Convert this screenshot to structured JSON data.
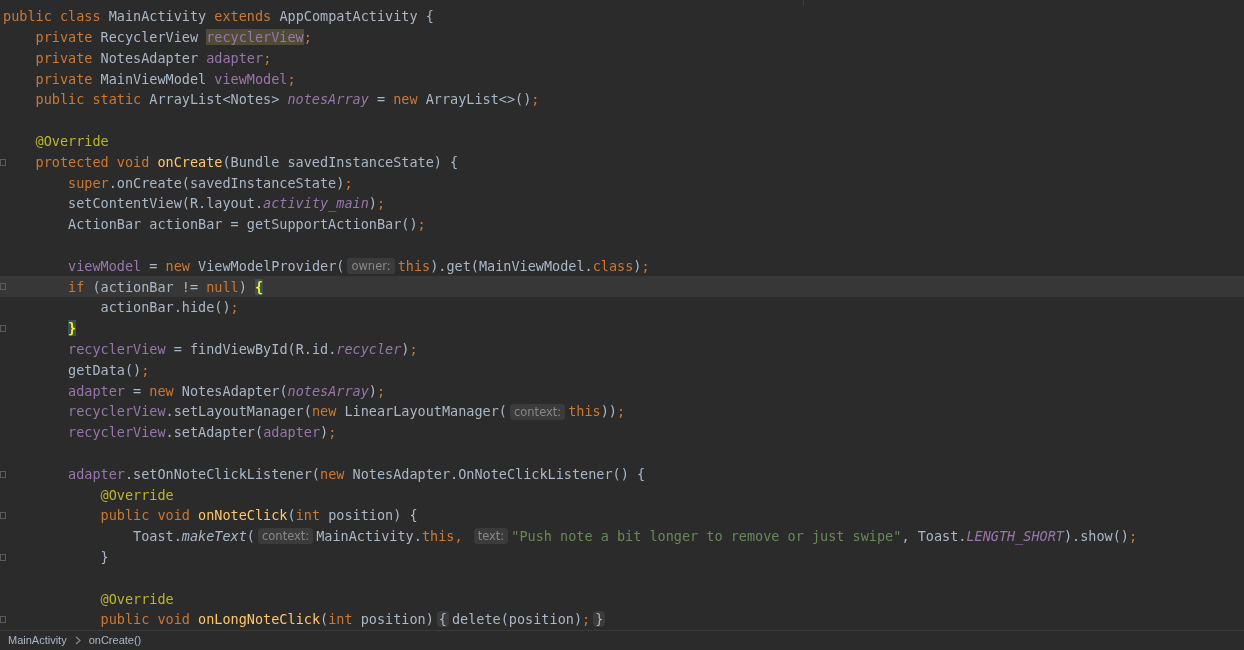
{
  "editor": {
    "lines": [
      {
        "fold_marker": false,
        "current": false,
        "tokens": [
          {
            "kind": "kw",
            "text": "public class "
          },
          {
            "kind": "plain",
            "text": "MainActivity "
          },
          {
            "kind": "kw",
            "text": "extends "
          },
          {
            "kind": "plain",
            "text": "AppCompatActivity {"
          }
        ]
      },
      {
        "fold_marker": false,
        "current": false,
        "tokens": [
          {
            "kind": "kw",
            "text": "    private "
          },
          {
            "kind": "plain",
            "text": "RecyclerView "
          },
          {
            "kind": "usage",
            "text": "recyclerView"
          },
          {
            "kind": "kw",
            "text": ";"
          }
        ]
      },
      {
        "fold_marker": false,
        "current": false,
        "tokens": [
          {
            "kind": "kw",
            "text": "    private "
          },
          {
            "kind": "plain",
            "text": "NotesAdapter "
          },
          {
            "kind": "field",
            "text": "adapter"
          },
          {
            "kind": "kw",
            "text": ";"
          }
        ]
      },
      {
        "fold_marker": false,
        "current": false,
        "tokens": [
          {
            "kind": "kw",
            "text": "    private "
          },
          {
            "kind": "plain",
            "text": "MainViewModel "
          },
          {
            "kind": "field",
            "text": "viewModel"
          },
          {
            "kind": "kw",
            "text": ";"
          }
        ]
      },
      {
        "fold_marker": false,
        "current": false,
        "tokens": [
          {
            "kind": "kw",
            "text": "    public static "
          },
          {
            "kind": "plain",
            "text": "ArrayList<Notes> "
          },
          {
            "kind": "static",
            "text": "notesArray"
          },
          {
            "kind": "plain",
            "text": " = "
          },
          {
            "kind": "kw",
            "text": "new "
          },
          {
            "kind": "plain",
            "text": "ArrayList<>()"
          },
          {
            "kind": "kw",
            "text": ";"
          }
        ]
      },
      {
        "fold_marker": false,
        "current": false
      },
      {
        "fold_marker": false,
        "current": false,
        "tokens": [
          {
            "kind": "annotation",
            "text": "    @Override"
          }
        ]
      },
      {
        "fold_marker": true,
        "current": false,
        "tokens": [
          {
            "kind": "kw",
            "text": "    protected void "
          },
          {
            "kind": "method",
            "text": "onCreate"
          },
          {
            "kind": "plain",
            "text": "(Bundle savedInstanceState) {"
          }
        ]
      },
      {
        "fold_marker": false,
        "current": false,
        "tokens": [
          {
            "kind": "kw",
            "text": "        super"
          },
          {
            "kind": "plain",
            "text": ".onCreate(savedInstanceState)"
          },
          {
            "kind": "kw",
            "text": ";"
          }
        ]
      },
      {
        "fold_marker": false,
        "current": false,
        "tokens": [
          {
            "kind": "plain",
            "text": "        setContentView(R.layout."
          },
          {
            "kind": "static",
            "text": "activity_main"
          },
          {
            "kind": "plain",
            "text": ")"
          },
          {
            "kind": "kw",
            "text": ";"
          }
        ]
      },
      {
        "fold_marker": false,
        "current": false,
        "tokens": [
          {
            "kind": "plain",
            "text": "        ActionBar actionBar = getSupportActionBar()"
          },
          {
            "kind": "kw",
            "text": ";"
          }
        ]
      },
      {
        "fold_marker": false,
        "current": false
      },
      {
        "fold_marker": false,
        "current": false,
        "tokens": [
          {
            "kind": "field",
            "text": "        viewModel"
          },
          {
            "kind": "plain",
            "text": " = "
          },
          {
            "kind": "kw",
            "text": "new "
          },
          {
            "kind": "plain",
            "text": "ViewModelProvider("
          },
          {
            "kind": "hint",
            "text": "owner:"
          },
          {
            "kind": "kw",
            "text": "this"
          },
          {
            "kind": "plain",
            "text": ").get(MainViewModel."
          },
          {
            "kind": "kw",
            "text": "class"
          },
          {
            "kind": "plain",
            "text": ")"
          },
          {
            "kind": "kw",
            "text": ";"
          }
        ]
      },
      {
        "fold_marker": true,
        "current": true,
        "tokens": [
          {
            "kind": "kw",
            "text": "        if "
          },
          {
            "kind": "plain",
            "text": "(actionBar != "
          },
          {
            "kind": "kw",
            "text": "null"
          },
          {
            "kind": "plain",
            "text": ") "
          },
          {
            "kind": "brace",
            "text": "{"
          }
        ]
      },
      {
        "fold_marker": false,
        "current": false,
        "tokens": [
          {
            "kind": "plain",
            "text": "            actionBar.hide()"
          },
          {
            "kind": "kw",
            "text": ";"
          }
        ]
      },
      {
        "fold_marker": true,
        "current": false,
        "tokens": [
          {
            "kind": "brace",
            "text": "        }"
          }
        ]
      },
      {
        "fold_marker": false,
        "current": false,
        "tokens": [
          {
            "kind": "field",
            "text": "        recyclerView"
          },
          {
            "kind": "plain",
            "text": " = findViewById(R.id."
          },
          {
            "kind": "static",
            "text": "recycler"
          },
          {
            "kind": "plain",
            "text": ")"
          },
          {
            "kind": "kw",
            "text": ";"
          }
        ]
      },
      {
        "fold_marker": false,
        "current": false,
        "tokens": [
          {
            "kind": "plain",
            "text": "        getData()"
          },
          {
            "kind": "kw",
            "text": ";"
          }
        ]
      },
      {
        "fold_marker": false,
        "current": false,
        "tokens": [
          {
            "kind": "field",
            "text": "        adapter"
          },
          {
            "kind": "plain",
            "text": " = "
          },
          {
            "kind": "kw",
            "text": "new "
          },
          {
            "kind": "plain",
            "text": "NotesAdapter("
          },
          {
            "kind": "static",
            "text": "notesArray"
          },
          {
            "kind": "plain",
            "text": ")"
          },
          {
            "kind": "kw",
            "text": ";"
          }
        ]
      },
      {
        "fold_marker": false,
        "current": false,
        "tokens": [
          {
            "kind": "field",
            "text": "        recyclerView"
          },
          {
            "kind": "plain",
            "text": ".setLayoutManager("
          },
          {
            "kind": "kw",
            "text": "new "
          },
          {
            "kind": "plain",
            "text": "LinearLayoutManager("
          },
          {
            "kind": "hint",
            "text": "context:"
          },
          {
            "kind": "kw",
            "text": "this"
          },
          {
            "kind": "plain",
            "text": "))"
          },
          {
            "kind": "kw",
            "text": ";"
          }
        ]
      },
      {
        "fold_marker": false,
        "current": false,
        "tokens": [
          {
            "kind": "field",
            "text": "        recyclerView"
          },
          {
            "kind": "plain",
            "text": ".setAdapter("
          },
          {
            "kind": "field",
            "text": "adapter"
          },
          {
            "kind": "plain",
            "text": ")"
          },
          {
            "kind": "kw",
            "text": ";"
          }
        ]
      },
      {
        "fold_marker": false,
        "current": false
      },
      {
        "fold_marker": true,
        "current": false,
        "tokens": [
          {
            "kind": "field",
            "text": "        adapter"
          },
          {
            "kind": "plain",
            "text": ".setOnNoteClickListener("
          },
          {
            "kind": "kw",
            "text": "new "
          },
          {
            "kind": "plain",
            "text": "NotesAdapter.OnNoteClickListener() {"
          }
        ]
      },
      {
        "fold_marker": false,
        "current": false,
        "tokens": [
          {
            "kind": "annotation",
            "text": "            @Override"
          }
        ]
      },
      {
        "fold_marker": true,
        "current": false,
        "tokens": [
          {
            "kind": "kw",
            "text": "            public void "
          },
          {
            "kind": "method",
            "text": "onNoteClick"
          },
          {
            "kind": "plain",
            "text": "("
          },
          {
            "kind": "kw",
            "text": "int "
          },
          {
            "kind": "plain",
            "text": "position) {"
          }
        ]
      },
      {
        "fold_marker": false,
        "current": false,
        "tokens": [
          {
            "kind": "plain",
            "text": "                Toast."
          },
          {
            "kind": "italic",
            "text": "makeText"
          },
          {
            "kind": "plain",
            "text": "("
          },
          {
            "kind": "hint",
            "text": "context:"
          },
          {
            "kind": "plain",
            "text": "MainActivity."
          },
          {
            "kind": "kw",
            "text": "this, "
          },
          {
            "kind": "hint",
            "text": "text:"
          },
          {
            "kind": "string",
            "text": "\"Push note a bit longer to remove or just swipe\""
          },
          {
            "kind": "plain",
            "text": ", Toast."
          },
          {
            "kind": "static",
            "text": "LENGTH_SHORT"
          },
          {
            "kind": "plain",
            "text": ").show()"
          },
          {
            "kind": "kw",
            "text": ";"
          }
        ]
      },
      {
        "fold_marker": true,
        "current": false,
        "tokens": [
          {
            "kind": "plain",
            "text": "            }"
          }
        ]
      },
      {
        "fold_marker": false,
        "current": false
      },
      {
        "fold_marker": false,
        "current": false,
        "tokens": [
          {
            "kind": "annotation",
            "text": "            @Override"
          }
        ]
      },
      {
        "fold_marker": true,
        "current": false,
        "tokens": [
          {
            "kind": "kw",
            "text": "            public void "
          },
          {
            "kind": "method",
            "text": "onLongNoteClick"
          },
          {
            "kind": "plain",
            "text": "("
          },
          {
            "kind": "kw",
            "text": "int "
          },
          {
            "kind": "plain",
            "text": "position)"
          },
          {
            "kind": "fold",
            "text": "{"
          },
          {
            "kind": "plain",
            "text": "delete(position)"
          },
          {
            "kind": "kw",
            "text": ";"
          },
          {
            "kind": "fold",
            "text": "}"
          }
        ]
      }
    ]
  },
  "breadcrumbs": [
    "MainActivity",
    "onCreate()"
  ]
}
